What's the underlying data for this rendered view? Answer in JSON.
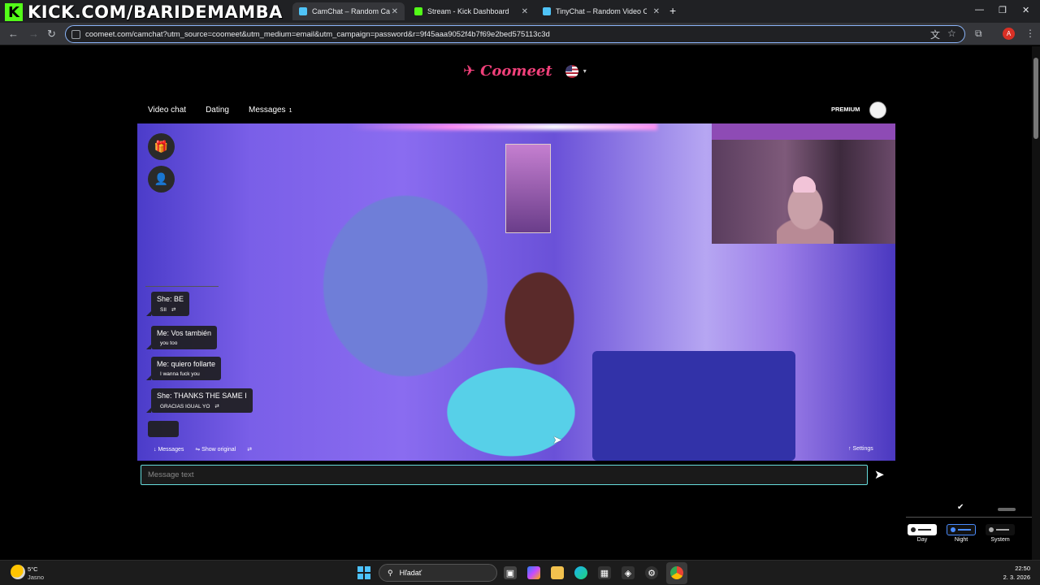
{
  "overlay": {
    "brand_letter": "K",
    "stream_text": "KICK.COM/BARIDEMAMBA"
  },
  "tabs": [
    {
      "title": "CamChat – Random Cam to",
      "icon_color": "#4fc3f7",
      "active": true
    },
    {
      "title": "Stream - Kick Dashboard",
      "icon_color": "#53fc18",
      "active": false
    },
    {
      "title": "TinyChat – Random Video Chat",
      "icon_color": "#4fc3f7",
      "active": false
    }
  ],
  "address": {
    "url": "coomeet.com/camchat?utm_source=coomeet&utm_medium=email&utm_campaign=password&r=9f45aaa9052f4b7f69e2bed575113c3d",
    "profile_initial": "A"
  },
  "site": {
    "logo": "Coomeet",
    "nav": {
      "video_chat": "Video chat",
      "dating": "Dating",
      "messages": "Messages",
      "messages_count": "1"
    },
    "premium": "PREMIUM"
  },
  "chat": {
    "messages": [
      {
        "text": "She: BE",
        "translation": "SII"
      },
      {
        "text": "Me: Vos también",
        "translation": "you too"
      },
      {
        "text": "Me: quiero follarte",
        "translation": "I wanna fuck you"
      },
      {
        "text": "She: THANKS THE SAME I",
        "translation": "GRACIAS IGUAL YO"
      }
    ],
    "tools": {
      "messages": "Messages",
      "show_original": "Show original"
    },
    "settings": "Settings"
  },
  "input": {
    "placeholder": "Message text"
  },
  "theme": {
    "options": [
      {
        "label": "Day",
        "selected": false
      },
      {
        "label": "Night",
        "selected": true
      },
      {
        "label": "System",
        "selected": false
      }
    ]
  },
  "taskbar": {
    "weather_temp": "5°C",
    "weather_desc": "Jasno",
    "search_placeholder": "Hľadať",
    "time": "22:50",
    "date": "2. 3. 2026"
  },
  "colors": {
    "accent": "#f0407a",
    "kick_green": "#53fc18",
    "focus": "#8ab4f8"
  }
}
